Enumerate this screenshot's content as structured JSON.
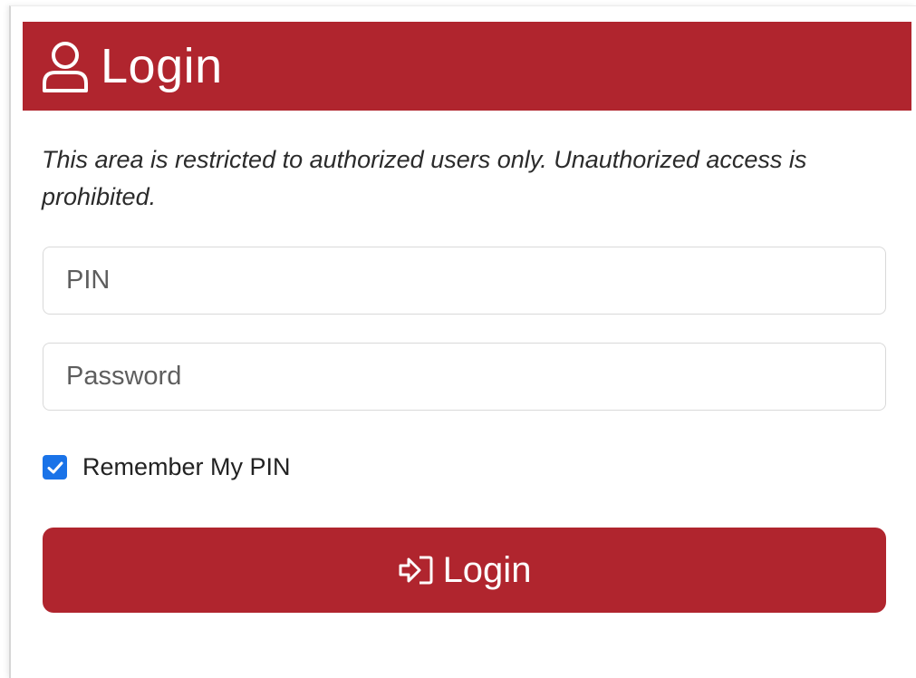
{
  "header": {
    "title": "Login",
    "icon": "user-icon",
    "background_color": "#b0252e"
  },
  "notice": {
    "text": "This area is restricted to authorized users only. Unauthorized access is prohibited."
  },
  "form": {
    "pin_placeholder": "PIN",
    "pin_value": "",
    "password_placeholder": "Password",
    "password_value": "",
    "remember_label": "Remember My PIN",
    "remember_checked": true,
    "checkbox_color": "#1a73e8",
    "submit_label": "Login",
    "submit_icon": "sign-in-icon",
    "submit_color": "#b0252e"
  }
}
